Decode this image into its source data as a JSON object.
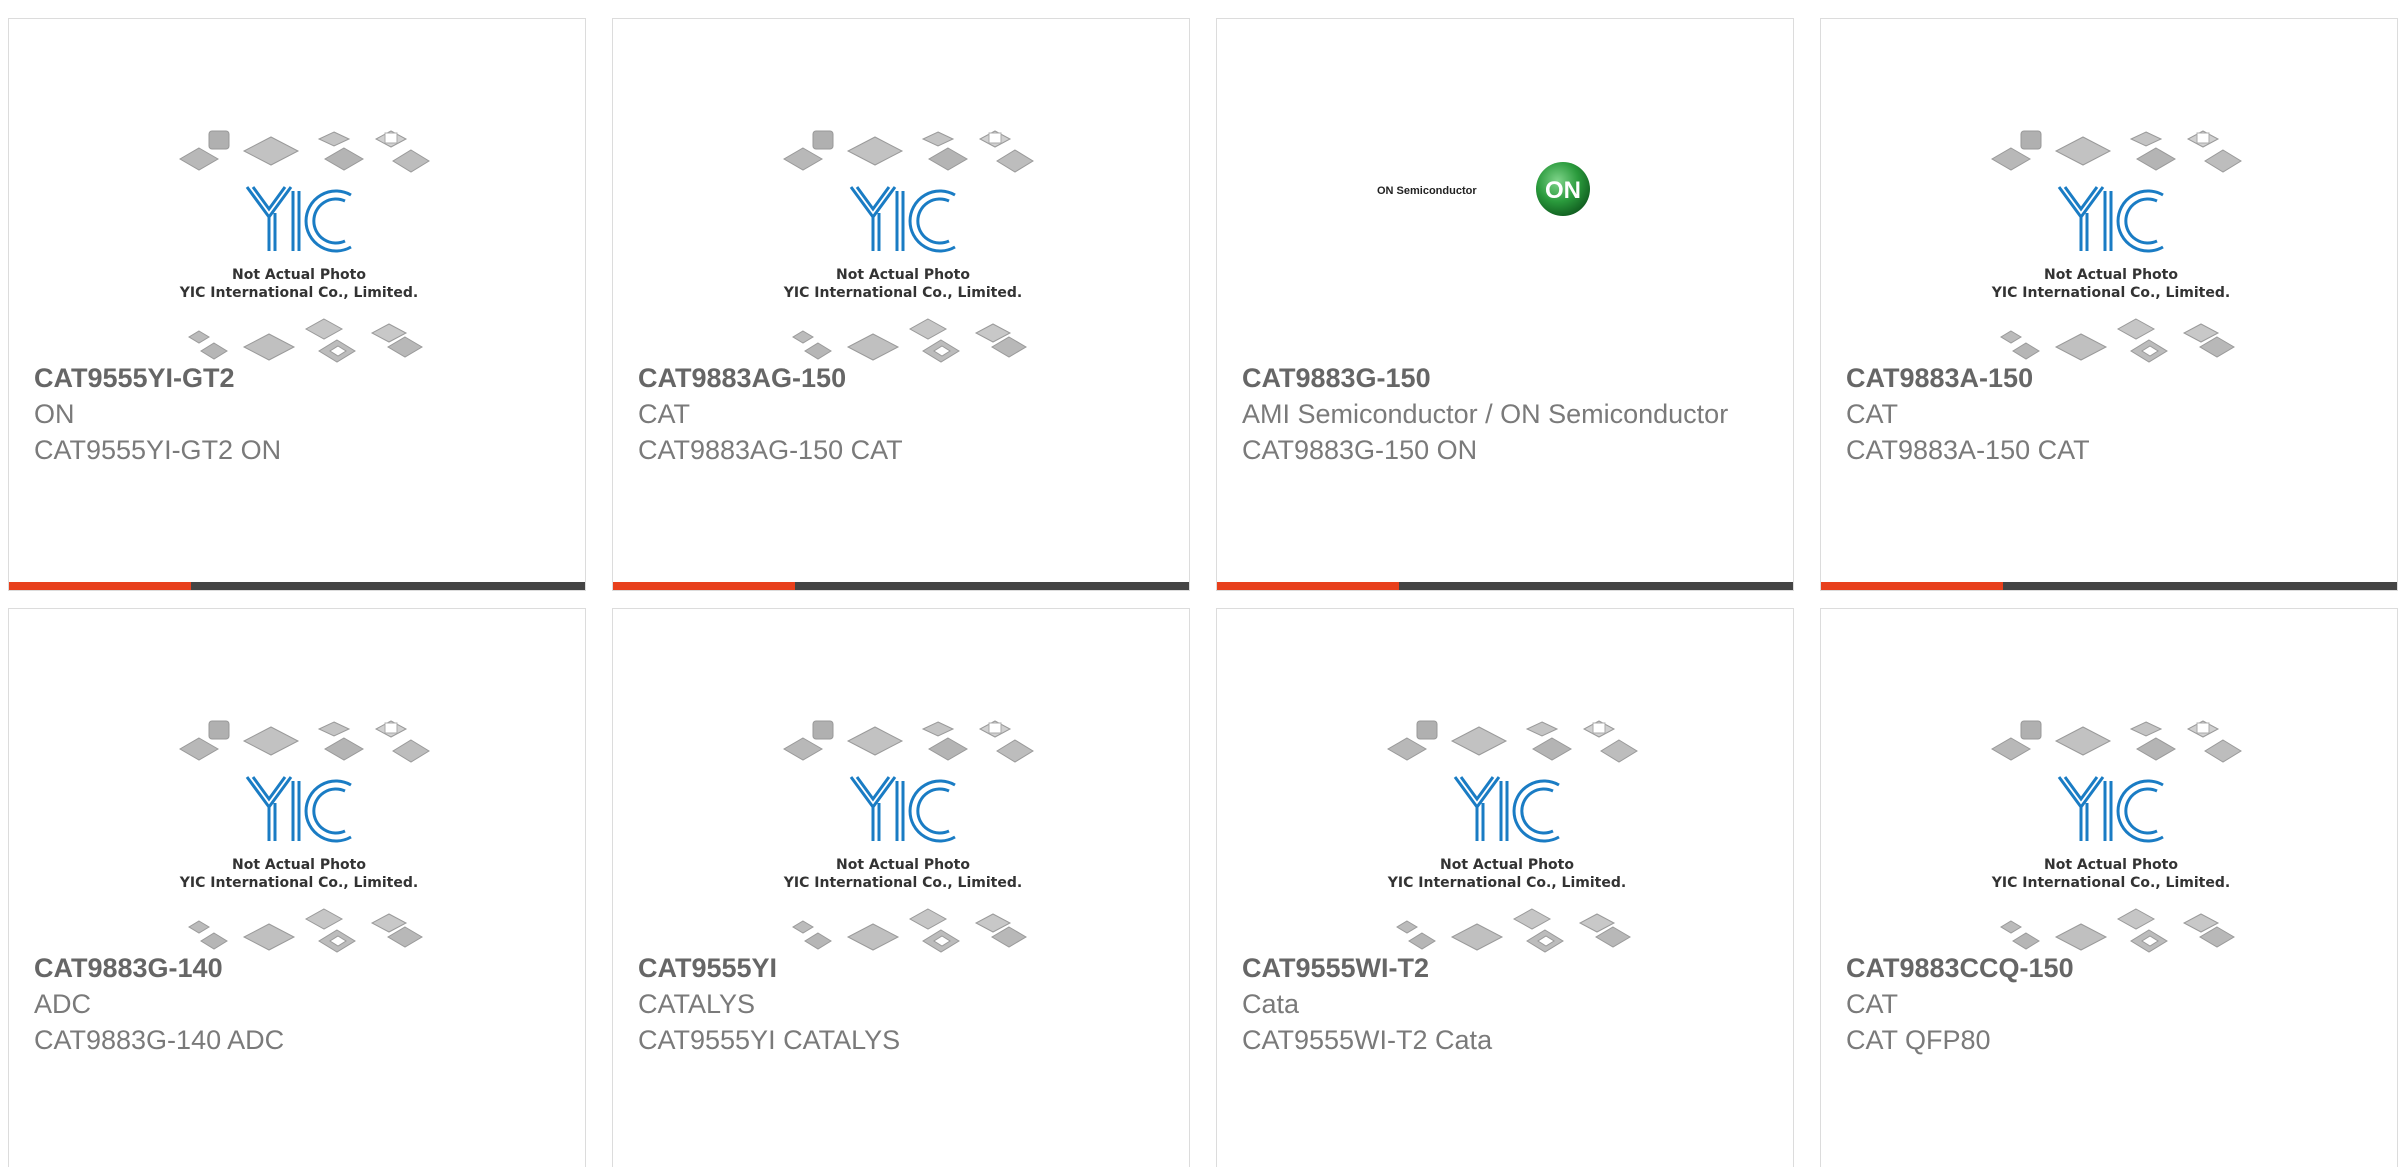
{
  "colors": {
    "accent": "#e8401c",
    "bar": "#444444",
    "logo_blue": "#1a7cc4",
    "on_green": "#2a9a3c"
  },
  "placeholder": {
    "line1": "Not Actual Photo",
    "line2": "YIC International Co., Limited."
  },
  "on_logo": {
    "wordmark": "ON Semiconductor",
    "badge": "ON"
  },
  "products": [
    {
      "part": "CAT9555YI-GT2",
      "manufacturer": "ON",
      "description": "CAT9555YI-GT2 ON",
      "image": "yic-placeholder"
    },
    {
      "part": "CAT9883AG-150",
      "manufacturer": "CAT",
      "description": "CAT9883AG-150 CAT",
      "image": "yic-placeholder"
    },
    {
      "part": "CAT9883G-150",
      "manufacturer": "AMI Semiconductor / ON Semiconductor",
      "description": "CAT9883G-150 ON",
      "image": "on-semiconductor-logo"
    },
    {
      "part": "CAT9883A-150",
      "manufacturer": "CAT",
      "description": "CAT9883A-150 CAT",
      "image": "yic-placeholder"
    },
    {
      "part": "CAT9883G-140",
      "manufacturer": "ADC",
      "description": "CAT9883G-140 ADC",
      "image": "yic-placeholder"
    },
    {
      "part": "CAT9555YI",
      "manufacturer": "CATALYS",
      "description": "CAT9555YI CATALYS",
      "image": "yic-placeholder"
    },
    {
      "part": "CAT9555WI-T2",
      "manufacturer": "Cata",
      "description": "CAT9555WI-T2 Cata",
      "image": "yic-placeholder"
    },
    {
      "part": "CAT9883CCQ-150",
      "manufacturer": "CAT",
      "description": "CAT QFP80",
      "image": "yic-placeholder"
    }
  ]
}
